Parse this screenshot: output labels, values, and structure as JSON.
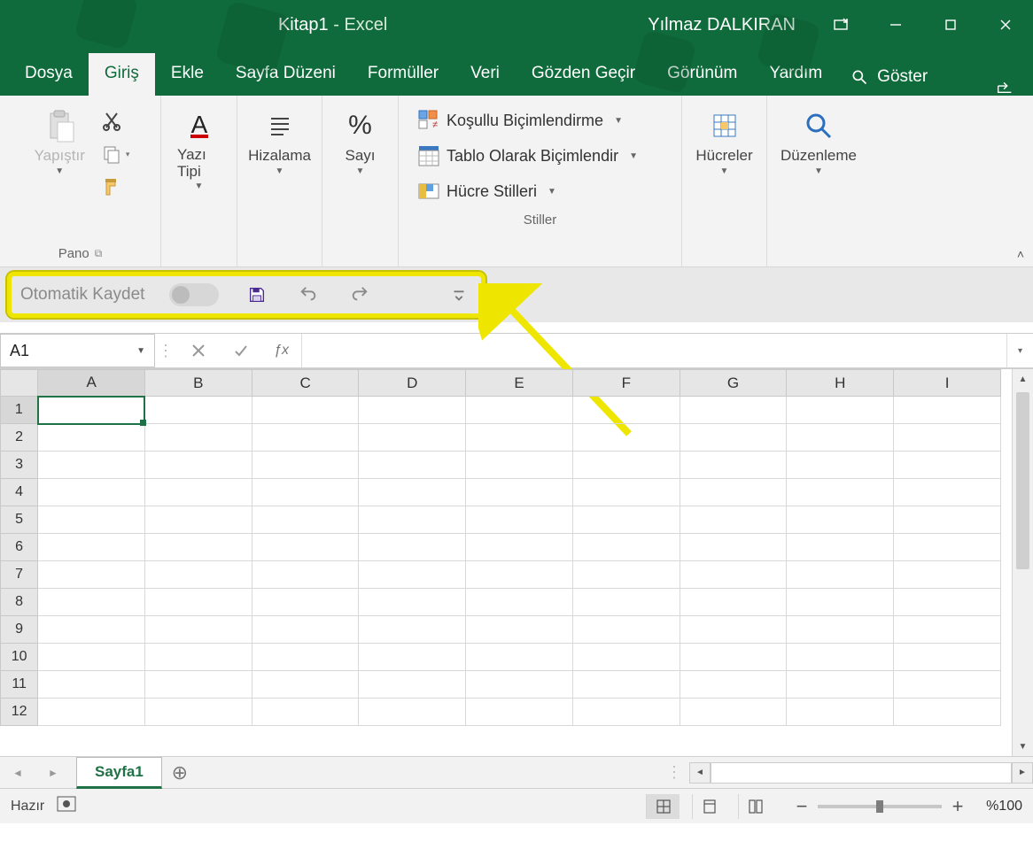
{
  "title": {
    "doc": "Kitap1",
    "sep": "  -  ",
    "app": "Excel",
    "user": "Yılmaz DALKIRAN"
  },
  "tabs": {
    "items": [
      "Dosya",
      "Giriş",
      "Ekle",
      "Sayfa Düzeni",
      "Formüller",
      "Veri",
      "Gözden Geçir",
      "Görünüm",
      "Yardım"
    ],
    "active_index": 1,
    "search_label": "Göster"
  },
  "ribbon": {
    "pano": {
      "paste": "Yapıştır",
      "label": "Pano"
    },
    "font": {
      "btn": "Yazı Tipi"
    },
    "align": {
      "btn": "Hizalama"
    },
    "number": {
      "btn": "Sayı",
      "symbol": "%"
    },
    "styles": {
      "cond": "Koşullu Biçimlendirme",
      "table": "Tablo Olarak Biçimlendir",
      "cell": "Hücre Stilleri",
      "label": "Stiller"
    },
    "cells": {
      "btn": "Hücreler"
    },
    "editing": {
      "btn": "Düzenleme"
    }
  },
  "qat": {
    "label": "Otomatik Kaydet"
  },
  "formula": {
    "namebox": "A1",
    "fx": "ƒx"
  },
  "grid": {
    "columns": [
      "A",
      "B",
      "C",
      "D",
      "E",
      "F",
      "G",
      "H",
      "I"
    ],
    "rows": [
      1,
      2,
      3,
      4,
      5,
      6,
      7,
      8,
      9,
      10,
      11,
      12
    ],
    "active": "A1"
  },
  "sheet": {
    "tab": "Sayfa1"
  },
  "status": {
    "ready": "Hazır",
    "zoom": "%100"
  }
}
